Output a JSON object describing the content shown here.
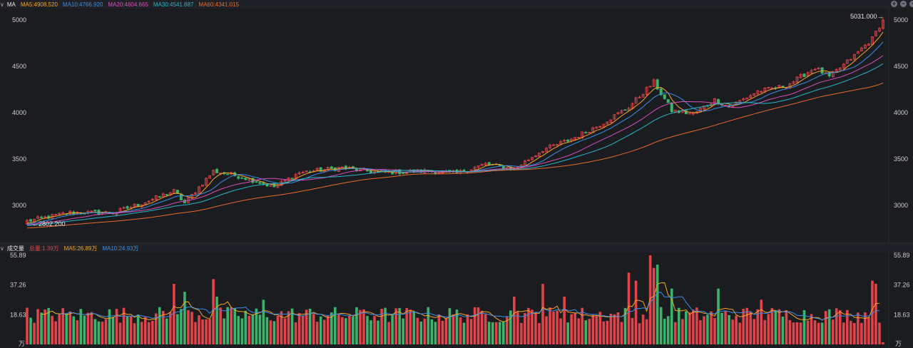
{
  "header": {
    "title": "MA",
    "legend": [
      {
        "label": "MA5:4908.520",
        "color": "#f5a623"
      },
      {
        "label": "MA10:4766.920",
        "color": "#3a8ee6"
      },
      {
        "label": "MA20:4604.665",
        "color": "#d94fbf"
      },
      {
        "label": "MA30:4541.887",
        "color": "#28b5c9"
      },
      {
        "label": "MA60:4341.015",
        "color": "#e86a2b"
      }
    ],
    "icons": [
      "plus-circle-icon",
      "minus-circle-icon",
      "settings-icon"
    ]
  },
  "volume_header": {
    "title": "成交量",
    "legend": [
      {
        "label": "总量:1.39万",
        "color": "#e0434a"
      },
      {
        "label": "MA5:26.89万",
        "color": "#f5a623"
      },
      {
        "label": "MA10:24.93万",
        "color": "#3a8ee6"
      }
    ]
  },
  "colors": {
    "up": "#e0434a",
    "down": "#3bb36b",
    "background": "#1b1c20"
  },
  "chart_data": [
    {
      "type": "candlestick",
      "title": "MA",
      "count": 240,
      "ylim": [
        2700,
        5060
      ],
      "yticks": [
        "5000",
        "4500",
        "4000",
        "3500",
        "3000"
      ],
      "ytick_values": [
        5000,
        4500,
        4000,
        3500,
        3000
      ],
      "close_anchors": [
        [
          0,
          2830
        ],
        [
          12,
          2923
        ],
        [
          24,
          2920
        ],
        [
          32,
          3023
        ],
        [
          41,
          3154
        ],
        [
          44,
          3023
        ],
        [
          52,
          3370
        ],
        [
          60,
          3308
        ],
        [
          69,
          3200
        ],
        [
          76,
          3354
        ],
        [
          88,
          3408
        ],
        [
          98,
          3354
        ],
        [
          112,
          3370
        ],
        [
          120,
          3346
        ],
        [
          128,
          3446
        ],
        [
          136,
          3392
        ],
        [
          144,
          3600
        ],
        [
          152,
          3715
        ],
        [
          160,
          3870
        ],
        [
          168,
          4062
        ],
        [
          175,
          4330
        ],
        [
          180,
          4023
        ],
        [
          186,
          3985
        ],
        [
          192,
          4138
        ],
        [
          196,
          4062
        ],
        [
          204,
          4230
        ],
        [
          212,
          4290
        ],
        [
          220,
          4485
        ],
        [
          224,
          4385
        ],
        [
          231,
          4615
        ],
        [
          236,
          4800
        ],
        [
          239,
          5000
        ]
      ],
      "max_marker": {
        "label": "5031.000→",
        "value": 5031.0
      },
      "min_marker": {
        "label": "←2802.200",
        "value": 2802.2
      },
      "ma_periods": [
        5,
        10,
        20,
        30,
        60
      ]
    },
    {
      "type": "bar",
      "title": "成交量",
      "unit": "万",
      "ylim": [
        0,
        55.89
      ],
      "yticks": [
        "55.89",
        "37.26",
        "18.63"
      ],
      "ytick_values": [
        55.89,
        37.26,
        18.63
      ],
      "base_level": 19,
      "spikes": [
        [
          41,
          38
        ],
        [
          44,
          33
        ],
        [
          52,
          41
        ],
        [
          53,
          30
        ],
        [
          66,
          28
        ],
        [
          94,
          22
        ],
        [
          136,
          30
        ],
        [
          144,
          38
        ],
        [
          150,
          30
        ],
        [
          168,
          45
        ],
        [
          170,
          40
        ],
        [
          174,
          55.89
        ],
        [
          175,
          48
        ],
        [
          176,
          50
        ],
        [
          180,
          35
        ],
        [
          193,
          35
        ],
        [
          205,
          28
        ],
        [
          236,
          40
        ],
        [
          237,
          38
        ]
      ],
      "last_value": 1.39,
      "ma_periods": [
        5,
        10
      ]
    }
  ]
}
